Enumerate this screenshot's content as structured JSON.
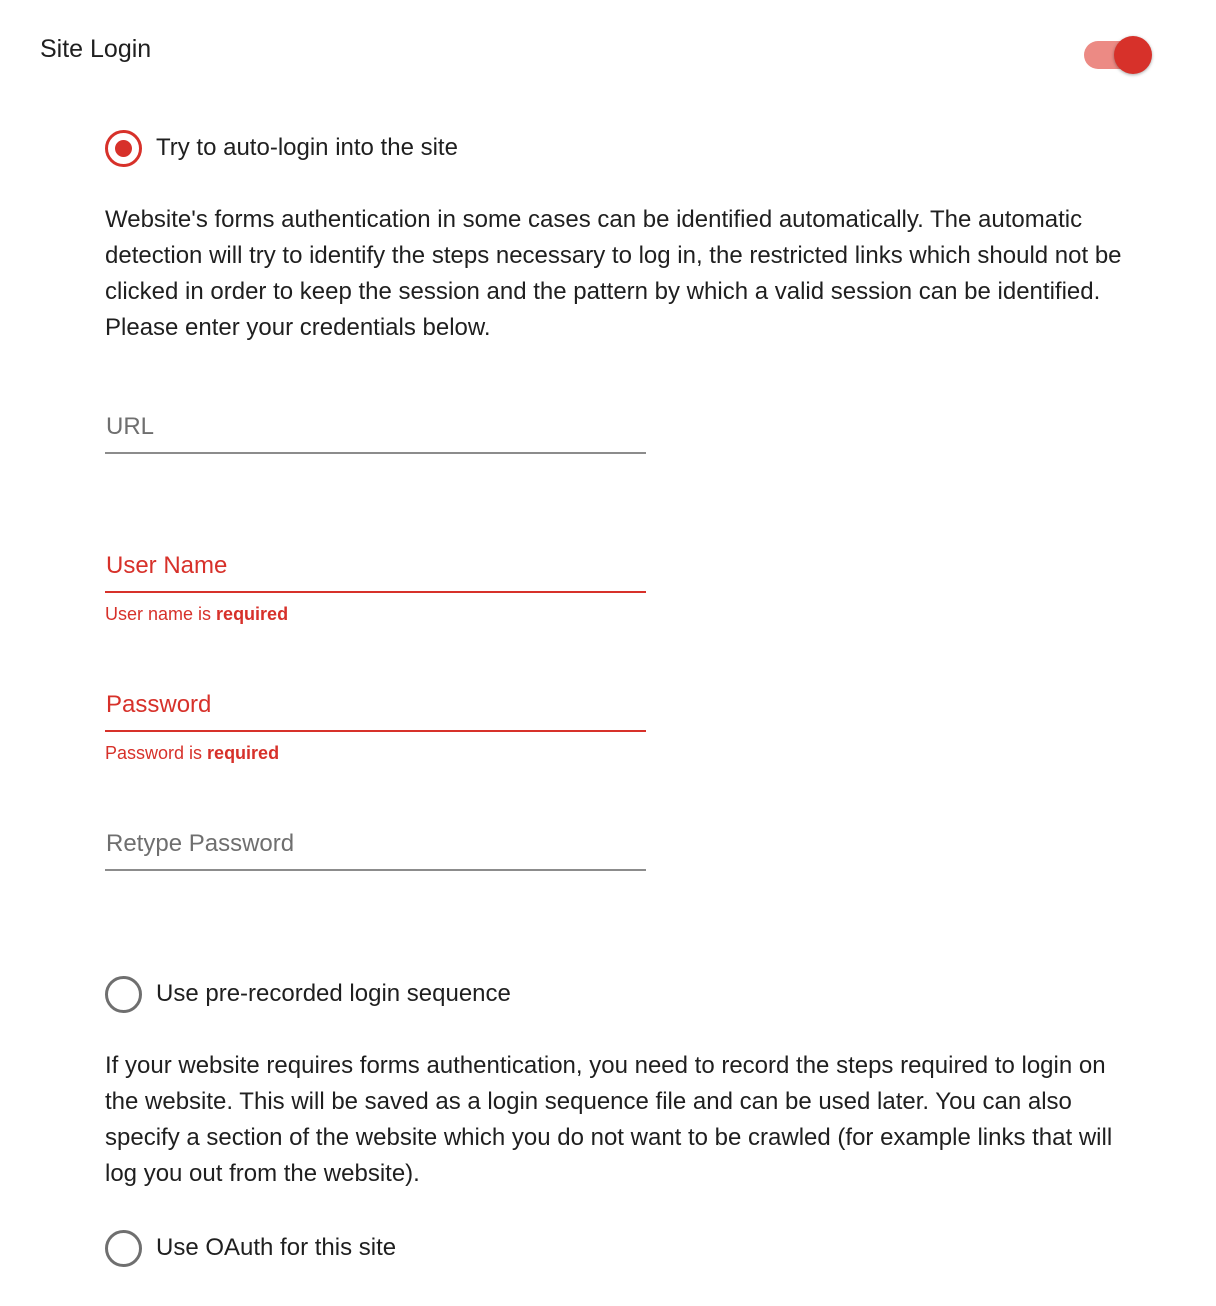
{
  "section": {
    "title": "Site Login",
    "enabled": true
  },
  "auto_login": {
    "label": "Try to auto-login into the site",
    "selected": true,
    "description": "Website's forms authentication in some cases can be identified automatically. The automatic detection will try to identify the steps necessary to log in, the restricted links which should not be clicked in order to keep the session and the pattern by which a valid session can be identified. Please enter your credentials below.",
    "fields": {
      "url": {
        "placeholder": "URL",
        "value": ""
      },
      "user_name": {
        "placeholder": "User Name",
        "value": "",
        "error_prefix": "User name is ",
        "error_emphasis": "required"
      },
      "password": {
        "placeholder": "Password",
        "value": "",
        "error_prefix": "Password is ",
        "error_emphasis": "required"
      },
      "retype_password": {
        "placeholder": "Retype Password",
        "value": ""
      }
    }
  },
  "prerecorded": {
    "label": "Use pre-recorded login sequence",
    "selected": false,
    "description": "If your website requires forms authentication, you need to record the steps required to login on the website. This will be saved as a login sequence file and can be used later. You can also specify a section of the website which you do not want to be crawled (for example links that will log you out from the website)."
  },
  "oauth": {
    "label": "Use OAuth for this site",
    "selected": false
  },
  "colors": {
    "accent": "#d7312a",
    "accent_light": "#ec8a84",
    "text": "#1f1f1f",
    "muted": "#6f6f6f"
  }
}
